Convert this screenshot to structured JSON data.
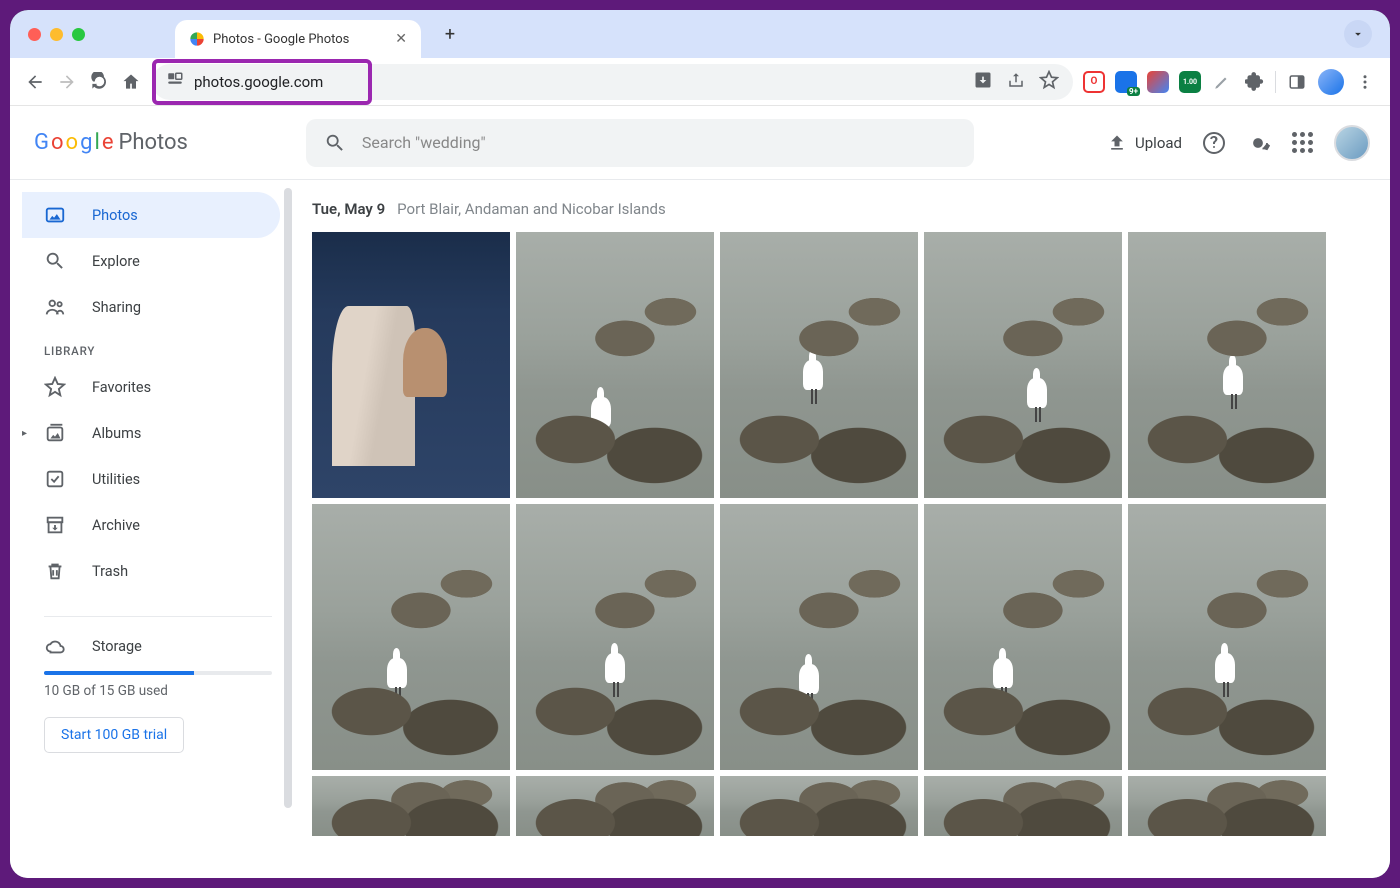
{
  "browser": {
    "tab_title": "Photos - Google Photos",
    "url": "photos.google.com",
    "ext_badges": {
      "blue": "9+",
      "green": "1.00"
    }
  },
  "header": {
    "logo_suffix": "Photos",
    "search_placeholder": "Search \"wedding\"",
    "upload_label": "Upload"
  },
  "sidebar": {
    "items": [
      {
        "label": "Photos"
      },
      {
        "label": "Explore"
      },
      {
        "label": "Sharing"
      }
    ],
    "library_header": "LIBRARY",
    "library": [
      {
        "label": "Favorites"
      },
      {
        "label": "Albums"
      },
      {
        "label": "Utilities"
      },
      {
        "label": "Archive"
      },
      {
        "label": "Trash"
      }
    ],
    "storage_label": "Storage",
    "storage_text": "10 GB of 15 GB used",
    "trial_label": "Start 100 GB trial"
  },
  "content": {
    "date": "Tue, May 9",
    "location": "Port Blair, Andaman and Nicobar Islands"
  }
}
